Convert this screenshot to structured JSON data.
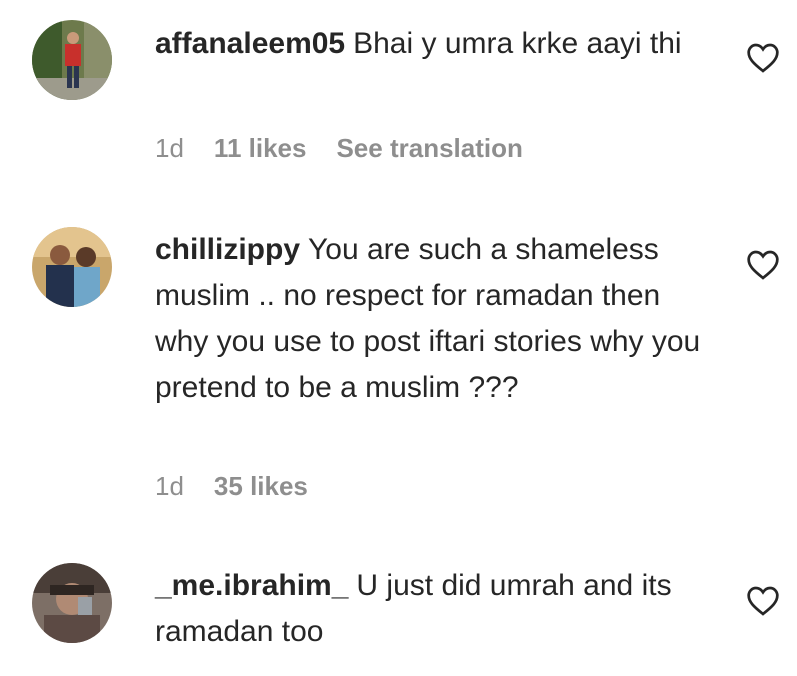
{
  "comments": [
    {
      "username": "affanaleem05",
      "text": "Bhai y umra krke aayi thi",
      "time": "1d",
      "likes": "11 likes",
      "translate": "See translation"
    },
    {
      "username": "chillizippy",
      "text": "You are such a shameless muslim .. no respect for ramadan then why you use to post iftari stories why you pretend to be a muslim ???",
      "time": "1d",
      "likes": "35 likes"
    },
    {
      "username": "_me.ibrahim_",
      "text": "U just did umrah and its ramadan too"
    }
  ],
  "icons": {
    "like": "heart-outline-icon",
    "avatar": "user-avatar"
  },
  "colors": {
    "text": "#262626",
    "meta": "#8e8e8e",
    "background": "#ffffff"
  }
}
